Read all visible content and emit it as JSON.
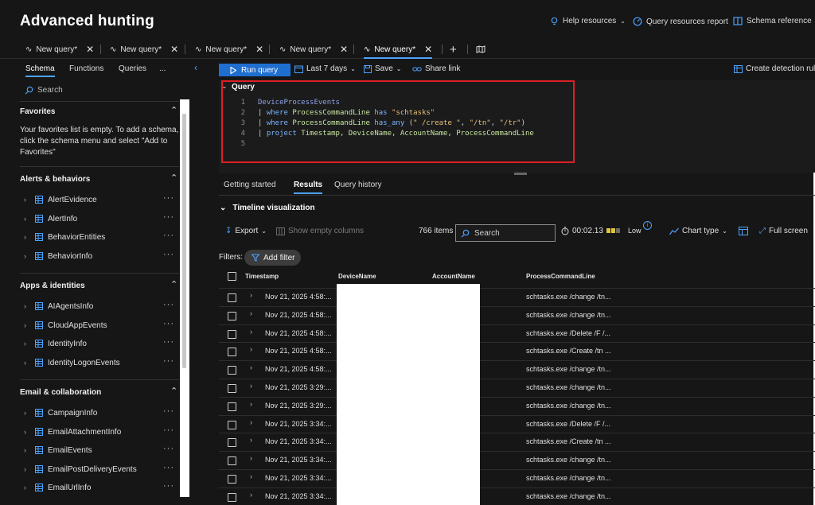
{
  "header": {
    "title": "Advanced hunting",
    "links": [
      {
        "label": "Help resources",
        "icon": "lightbulb-icon"
      },
      {
        "label": "Query resources report",
        "icon": "gauge-icon"
      },
      {
        "label": "Schema reference",
        "icon": "book-icon"
      }
    ]
  },
  "tabs": [
    {
      "label": "New query*",
      "active": false
    },
    {
      "label": "New query*",
      "active": false
    },
    {
      "label": "New query*",
      "active": false
    },
    {
      "label": "New query*",
      "active": false
    },
    {
      "label": "New query*",
      "active": true
    }
  ],
  "sidebar": {
    "tabs": [
      "Schema",
      "Functions",
      "Queries"
    ],
    "more": "...",
    "search_placeholder": "Search",
    "favorites": {
      "title": "Favorites",
      "empty_text_1": "Your favorites list is empty. To add a schema,",
      "empty_text_2": "click the schema menu and select \"Add to",
      "empty_text_3": "Favorites\""
    },
    "sections": [
      {
        "title": "Alerts & behaviors",
        "items": [
          "AlertEvidence",
          "AlertInfo",
          "BehaviorEntities",
          "BehaviorInfo"
        ]
      },
      {
        "title": "Apps & identities",
        "items": [
          "AIAgentsInfo",
          "CloudAppEvents",
          "IdentityInfo",
          "IdentityLogonEvents"
        ]
      },
      {
        "title": "Email & collaboration",
        "items": [
          "CampaignInfo",
          "EmailAttachmentInfo",
          "EmailEvents",
          "EmailPostDeliveryEvents",
          "EmailUrlInfo"
        ]
      }
    ],
    "item_menu": "···"
  },
  "toolbar": {
    "run": "Run query",
    "time_range": "Last 7 days",
    "save": "Save",
    "share": "Share link",
    "create_rule": "Create detection rule"
  },
  "editor": {
    "label": "Query",
    "line_numbers": [
      "1",
      "2",
      "3",
      "4",
      "5"
    ],
    "lines": {
      "l1": "DeviceProcessEvents",
      "l2_pipe": "| ",
      "l2_kw": "where",
      "l2_col": "ProcessCommandLine",
      "l2_op": "has",
      "l2_str": "\"schtasks\"",
      "l3_pipe": "| ",
      "l3_kw": "where",
      "l3_col": "ProcessCommandLine",
      "l3_op": "has_any",
      "l3_open": "(",
      "l3_s1": "\" /create \"",
      "l3_c1": ", ",
      "l3_s2": "\"/tn\"",
      "l3_c2": ", ",
      "l3_s3": "\"/tr\"",
      "l3_close": ")",
      "l4_pipe": "| ",
      "l4_kw": "project",
      "l4_cols": "Timestamp, DeviceName, AccountName, ProcessCommandLine"
    }
  },
  "results_tabs": [
    {
      "label": "Getting started",
      "active": false
    },
    {
      "label": "Results",
      "active": true
    },
    {
      "label": "Query history",
      "active": false
    }
  ],
  "timeline": "Timeline visualization",
  "results_toolbar": {
    "export": "Export",
    "show_empty": "Show empty columns",
    "count": "766 items",
    "search_placeholder": "Search",
    "duration": "00:02.13",
    "usage": "Low",
    "chart_type": "Chart type",
    "full_screen": "Full screen"
  },
  "filters": {
    "label": "Filters:",
    "add": "Add filter"
  },
  "table": {
    "columns": [
      "Timestamp",
      "DeviceName",
      "AccountName",
      "ProcessCommandLine"
    ],
    "rows": [
      {
        "ts": "Nov 21, 2025 4:58:...",
        "cmd": "schtasks.exe /change /tn..."
      },
      {
        "ts": "Nov 21, 2025 4:58:...",
        "cmd": "schtasks.exe /change /tn..."
      },
      {
        "ts": "Nov 21, 2025 4:58:...",
        "cmd": "schtasks.exe /Delete /F /..."
      },
      {
        "ts": "Nov 21, 2025 4:58:...",
        "cmd": "schtasks.exe /Create /tn ..."
      },
      {
        "ts": "Nov 21, 2025 4:58:...",
        "cmd": "schtasks.exe /change /tn..."
      },
      {
        "ts": "Nov 21, 2025 3:29:...",
        "cmd": "schtasks.exe /change /tn..."
      },
      {
        "ts": "Nov 21, 2025 3:29:...",
        "cmd": "schtasks.exe /change /tn..."
      },
      {
        "ts": "Nov 21, 2025 3:34:...",
        "cmd": "schtasks.exe /Delete /F /..."
      },
      {
        "ts": "Nov 21, 2025 3:34:...",
        "cmd": "schtasks.exe /Create /tn ..."
      },
      {
        "ts": "Nov 21, 2025 3:34:...",
        "cmd": "schtasks.exe /change /tn..."
      },
      {
        "ts": "Nov 21, 2025 3:34:...",
        "cmd": "schtasks.exe /change /tn..."
      },
      {
        "ts": "Nov 21, 2025 3:34:...",
        "cmd": "schtasks.exe /change /tn..."
      }
    ]
  },
  "colors": {
    "accent": "#4da3ff",
    "run_button": "#1f6fd1",
    "highlight_box": "#e01e26",
    "background": "#161616"
  }
}
